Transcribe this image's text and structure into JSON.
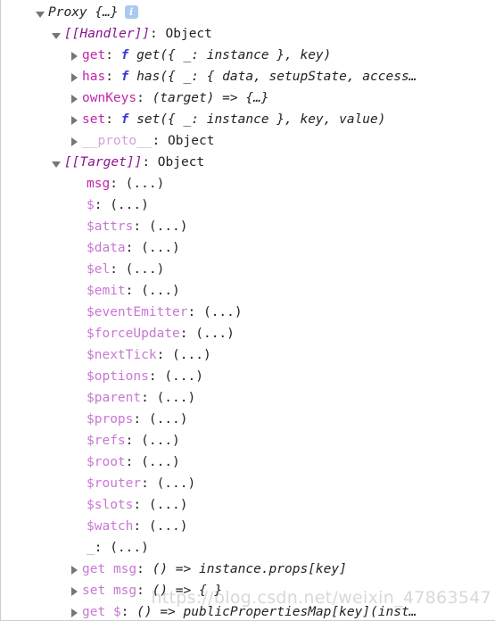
{
  "panel": {
    "kind": "devtools-object-inspector",
    "info_badge": "i",
    "watermark": "https://blog.csdn.net/weixin_47863547",
    "colors": {
      "internal_slot": "#881391",
      "own_property": "#c026a8",
      "accessor_property": "#c877d4",
      "proto_property": "#d49fd9",
      "function_keyword": "#3a3ad6",
      "value_text": "#222222",
      "info_badge_bg": "#a8caf0",
      "panel_border": "#cdcdcd"
    }
  },
  "root": {
    "label": "Proxy",
    "brace": "{…}",
    "expanded": true
  },
  "handler": {
    "label": "[[Handler]]",
    "separator": ":",
    "value": "Object",
    "expanded": true,
    "entries": [
      {
        "name": "get",
        "separator": ":",
        "keyword": "f",
        "signature": "get({ _: instance }, key)",
        "expanded": false,
        "kind": "own"
      },
      {
        "name": "has",
        "separator": ":",
        "keyword": "f",
        "signature": "has({ _: { data, setupState, access…",
        "expanded": false,
        "kind": "own"
      },
      {
        "name": "ownKeys",
        "separator": ":",
        "keyword": "",
        "signature": "(target) => {…}",
        "expanded": false,
        "kind": "own"
      },
      {
        "name": "set",
        "separator": ":",
        "keyword": "f",
        "signature": "set({ _: instance }, key, value)",
        "expanded": false,
        "kind": "own"
      },
      {
        "name": "__proto__",
        "separator": ":",
        "keyword": "",
        "signature": "Object",
        "expanded": false,
        "kind": "proto"
      }
    ]
  },
  "target": {
    "label": "[[Target]]",
    "separator": ":",
    "value": "Object",
    "expanded": true,
    "entries": [
      {
        "name": "msg",
        "separator": ":",
        "value": "(...)",
        "kind": "own"
      },
      {
        "name": "$",
        "separator": ":",
        "value": "(...)",
        "kind": "accessor"
      },
      {
        "name": "$attrs",
        "separator": ":",
        "value": "(...)",
        "kind": "accessor"
      },
      {
        "name": "$data",
        "separator": ":",
        "value": "(...)",
        "kind": "accessor"
      },
      {
        "name": "$el",
        "separator": ":",
        "value": "(...)",
        "kind": "accessor"
      },
      {
        "name": "$emit",
        "separator": ":",
        "value": "(...)",
        "kind": "accessor"
      },
      {
        "name": "$eventEmitter",
        "separator": ":",
        "value": "(...)",
        "kind": "accessor"
      },
      {
        "name": "$forceUpdate",
        "separator": ":",
        "value": "(...)",
        "kind": "accessor"
      },
      {
        "name": "$nextTick",
        "separator": ":",
        "value": "(...)",
        "kind": "accessor"
      },
      {
        "name": "$options",
        "separator": ":",
        "value": "(...)",
        "kind": "accessor"
      },
      {
        "name": "$parent",
        "separator": ":",
        "value": "(...)",
        "kind": "accessor"
      },
      {
        "name": "$props",
        "separator": ":",
        "value": "(...)",
        "kind": "accessor"
      },
      {
        "name": "$refs",
        "separator": ":",
        "value": "(...)",
        "kind": "accessor"
      },
      {
        "name": "$root",
        "separator": ":",
        "value": "(...)",
        "kind": "accessor"
      },
      {
        "name": "$router",
        "separator": ":",
        "value": "(...)",
        "kind": "accessor"
      },
      {
        "name": "$slots",
        "separator": ":",
        "value": "(...)",
        "kind": "accessor"
      },
      {
        "name": "$watch",
        "separator": ":",
        "value": "(...)",
        "kind": "accessor"
      },
      {
        "name": "_",
        "separator": ":",
        "value": "(...)",
        "kind": "accessor"
      }
    ],
    "accessors": [
      {
        "prefix": "get",
        "name": "msg",
        "separator": ":",
        "signature": "() => instance.props[key]",
        "expanded": false
      },
      {
        "prefix": "set",
        "name": "msg",
        "separator": ":",
        "signature": "() => { }",
        "expanded": false
      },
      {
        "prefix": "get",
        "name": "$",
        "separator": ":",
        "signature": "() => publicPropertiesMap[key](inst…",
        "expanded": false
      }
    ]
  }
}
